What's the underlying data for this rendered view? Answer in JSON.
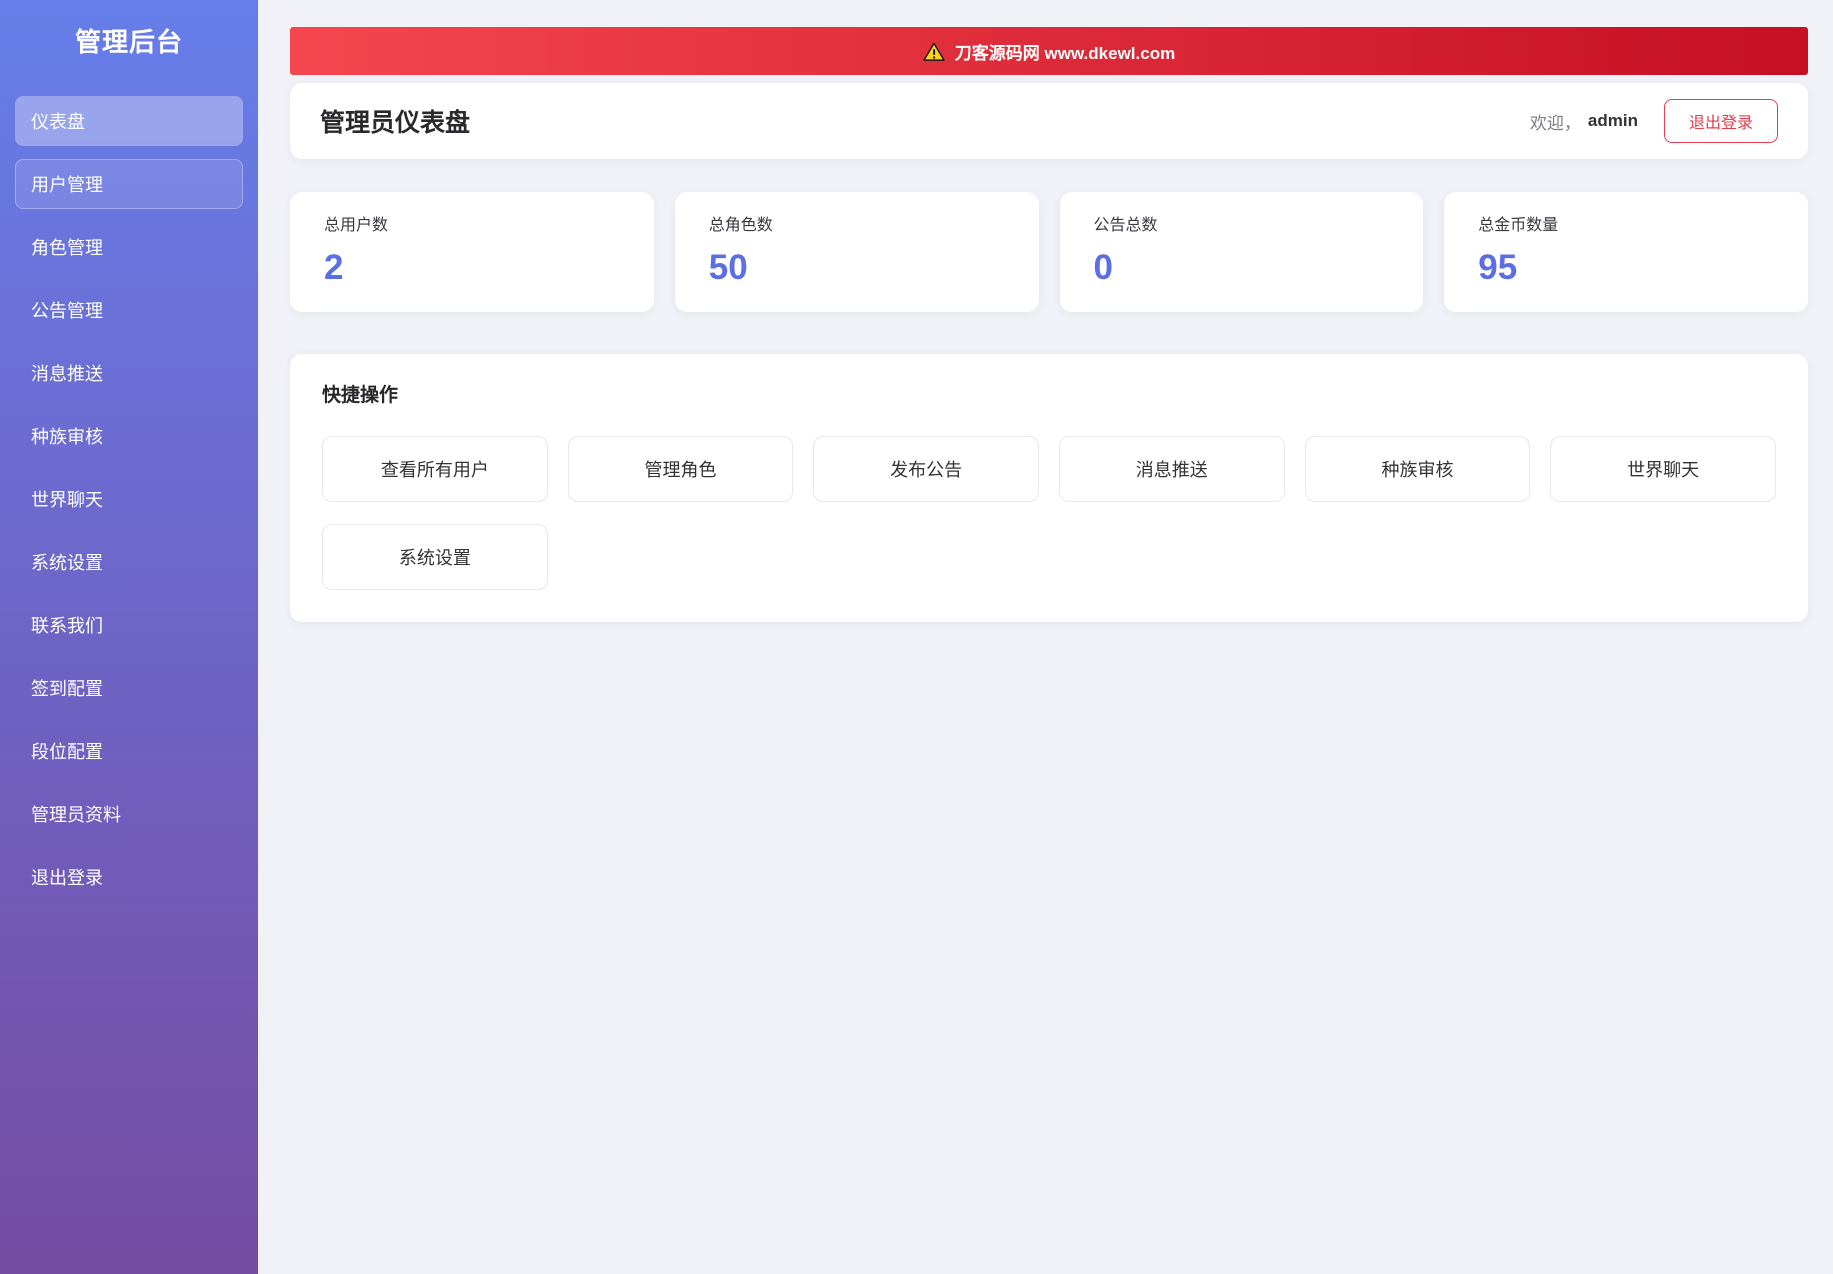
{
  "sidebar": {
    "title": "管理后台",
    "items": [
      {
        "label": "仪表盘",
        "name": "dashboard",
        "state": "active"
      },
      {
        "label": "用户管理",
        "name": "users",
        "state": "secondary"
      },
      {
        "label": "角色管理",
        "name": "roles"
      },
      {
        "label": "公告管理",
        "name": "announcements"
      },
      {
        "label": "消息推送",
        "name": "message-push"
      },
      {
        "label": "种族审核",
        "name": "race-review"
      },
      {
        "label": "世界聊天",
        "name": "world-chat"
      },
      {
        "label": "系统设置",
        "name": "settings"
      },
      {
        "label": "联系我们",
        "name": "contact"
      },
      {
        "label": "签到配置",
        "name": "checkin-config"
      },
      {
        "label": "段位配置",
        "name": "rank-config"
      },
      {
        "label": "管理员资料",
        "name": "admin-profile"
      },
      {
        "label": "退出登录",
        "name": "logout"
      }
    ]
  },
  "banner": {
    "icon": "warning-icon",
    "text": "刀客源码网 www.dkewl.com"
  },
  "header": {
    "title": "管理员仪表盘",
    "welcome_prefix": "欢迎，",
    "username": "admin",
    "logout_label": "退出登录"
  },
  "stats": [
    {
      "label": "总用户数",
      "value": "2"
    },
    {
      "label": "总角色数",
      "value": "50"
    },
    {
      "label": "公告总数",
      "value": "0"
    },
    {
      "label": "总金币数量",
      "value": "95"
    }
  ],
  "quick_actions": {
    "title": "快捷操作",
    "buttons": [
      {
        "label": "查看所有用户",
        "name": "view-all-users"
      },
      {
        "label": "管理角色",
        "name": "manage-roles"
      },
      {
        "label": "发布公告",
        "name": "publish-announcement"
      },
      {
        "label": "消息推送",
        "name": "message-push"
      },
      {
        "label": "种族审核",
        "name": "race-review"
      },
      {
        "label": "世界聊天",
        "name": "world-chat"
      },
      {
        "label": "系统设置",
        "name": "system-settings"
      }
    ]
  },
  "colors": {
    "sidebar_gradient_top": "#667eea",
    "sidebar_gradient_bottom": "#764ba2",
    "banner_gradient_left": "#f5464e",
    "banner_gradient_right": "#c60f23",
    "accent_value": "#5c6ee5",
    "logout_red": "#e0404d",
    "page_background": "#f0f2f7"
  }
}
